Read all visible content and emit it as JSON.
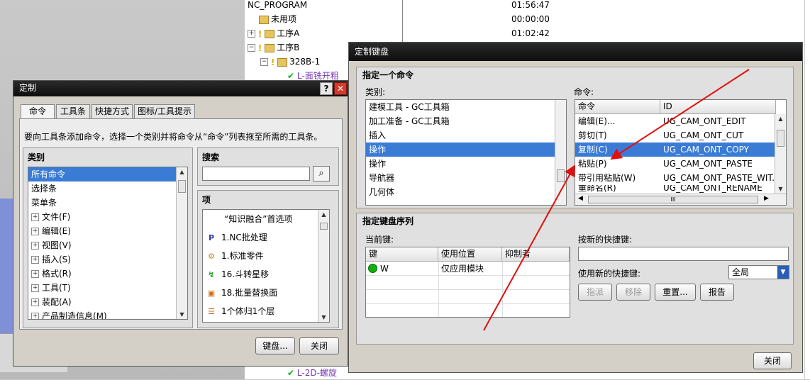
{
  "nav_tree": {
    "rows": [
      {
        "name": "NC_PROGRAM",
        "time": "01:56:47"
      },
      {
        "name": "未用项",
        "time": "00:00:00"
      },
      {
        "name": "工序A",
        "time": "01:02:42"
      },
      {
        "name": "工序B",
        "time": ""
      },
      {
        "name": "328B-1",
        "time": ""
      },
      {
        "name": "L-面铣开粗",
        "time": ""
      },
      {
        "name": "L-2D-螺旋",
        "time": ""
      }
    ]
  },
  "customize_dialog": {
    "title": "定制",
    "help_label": "?",
    "close_label": "✕",
    "tabs": [
      "命令",
      "工具条",
      "快捷方式",
      "图标/工具提示"
    ],
    "instruction": "要向工具条添加命令，选择一个类别并将命令从“命令”列表拖至所需的工具条。",
    "category_header": "类别",
    "categories": [
      "所有命令",
      "选择条",
      "菜单条",
      "文件(F)",
      "编辑(E)",
      "视图(V)",
      "插入(S)",
      "格式(R)",
      "工具(T)",
      "装配(A)",
      "产品制造信息(M)"
    ],
    "search_header": "搜索",
    "search_value": "",
    "items_header": "项",
    "items": [
      "“知识融合”首选项",
      "1.NC批处理",
      "1.标准零件",
      "16.斗转星移",
      "18.批量替换面",
      "1个体归1个层"
    ],
    "keyboard_button": "键盘...",
    "close_button": "关闭"
  },
  "keyboard_dialog": {
    "title": "定制键盘",
    "specify_command": "指定一个命令",
    "category_label": "类别:",
    "categories": [
      "建模工具 - GC工具箱",
      "加工准备 - GC工具箱",
      "插入",
      "操作",
      "操作",
      "导航器",
      "几何体"
    ],
    "command_label": "命令:",
    "cmd_col": "命令",
    "id_col": "ID",
    "commands": [
      {
        "cmd": "编辑(E)...",
        "id": "UG_CAM_ONT_EDIT"
      },
      {
        "cmd": "剪切(T)",
        "id": "UG_CAM_ONT_CUT"
      },
      {
        "cmd": "复制(C)",
        "id": "UG_CAM_ONT_COPY"
      },
      {
        "cmd": "粘贴(P)",
        "id": "UG_CAM_ONT_PASTE"
      },
      {
        "cmd": "带引用粘贴(W)",
        "id": "UG_CAM_ONT_PASTE_WIT..."
      },
      {
        "cmd": "重命名(R)",
        "id": "UG_CAM_ONT_RENAME"
      }
    ],
    "hscroll_mid": "III",
    "key_sequence": "指定键盘序列",
    "current_keys_label": "当前键:",
    "key_cols": [
      "键",
      "使用位置",
      "抑制者"
    ],
    "key_rows": [
      {
        "key": "W",
        "scope": "仅应用模块",
        "suppressor": ""
      }
    ],
    "new_shortcut_label": "按新的快捷键:",
    "new_shortcut_value": "",
    "use_new_label": "使用新的快捷键:",
    "scope_value": "全局",
    "assign_button": "指派",
    "remove_button": "移除",
    "reset_button": "重置...",
    "report_button": "报告",
    "close_button": "关闭"
  },
  "colors": {
    "selection": "#3a7bd5",
    "arrow": "#e01010",
    "status_green": "#10b010",
    "titlebar": "#1a1a1a"
  }
}
